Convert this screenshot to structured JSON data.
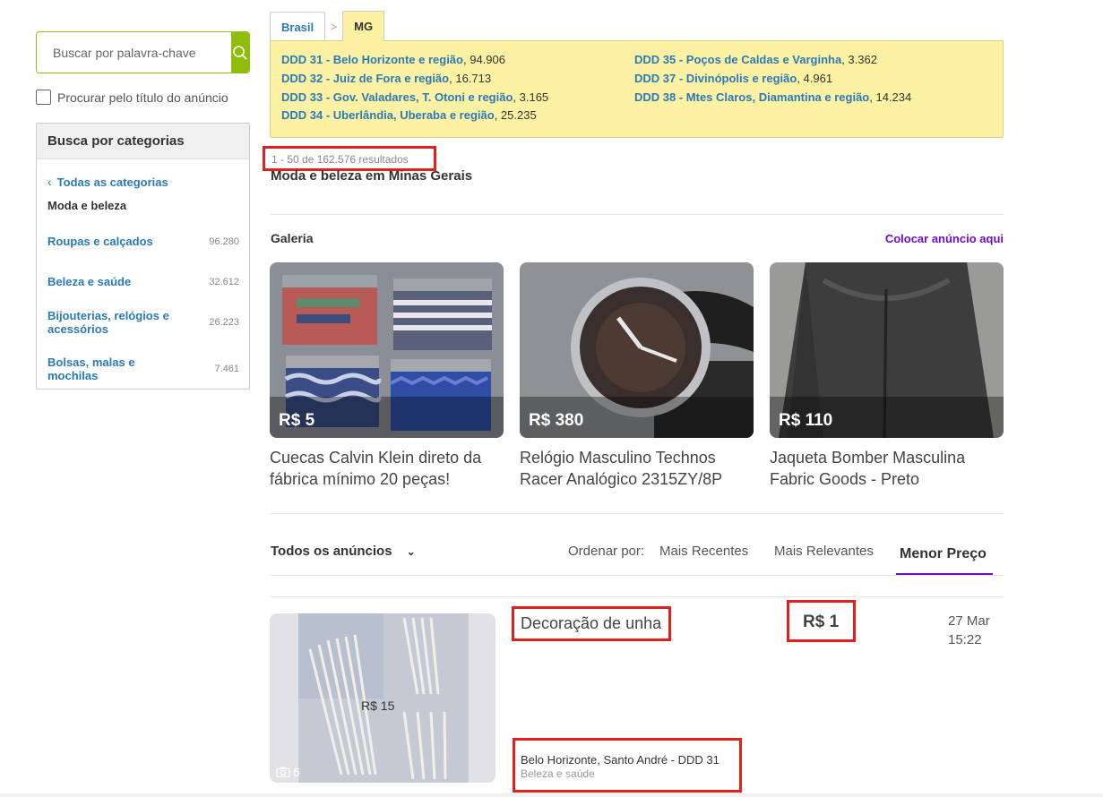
{
  "search": {
    "placeholder": "Buscar por palavra-chave",
    "title_only_label": "Procurar pelo título do anúncio"
  },
  "categories": {
    "heading": "Busca por categorias",
    "back_label": "Todas as categorias",
    "current": "Moda e beleza",
    "items": [
      {
        "label": "Roupas e calçados",
        "count": "96.280"
      },
      {
        "label": "Beleza e saúde",
        "count": "32.612"
      },
      {
        "label": "Bijouterias, relógios e acessórios",
        "count": "26.223"
      },
      {
        "label": "Bolsas, malas e mochilas",
        "count": "7.461"
      }
    ]
  },
  "location": {
    "tabs": [
      "Brasil",
      "MG"
    ],
    "separator": ">",
    "ddd": [
      {
        "name": "DDD 31 - Belo Horizonte e região",
        "count": ", 94.906"
      },
      {
        "name": "DDD 32 - Juiz de Fora e região",
        "count": ", 16.713"
      },
      {
        "name": "DDD 33 - Gov. Valadares, T. Otoni e região",
        "count": ", 3.165"
      },
      {
        "name": "DDD 34 - Uberlândia, Uberaba e região",
        "count": ", 25.235"
      },
      {
        "name": "DDD 35 - Poços de Caldas e Varginha",
        "count": ", 3.362"
      },
      {
        "name": "DDD 37 - Divinópolis e região",
        "count": ", 4.961"
      },
      {
        "name": "DDD 38 - Mtes Claros, Diamantina e região",
        "count": ", 14.234"
      }
    ]
  },
  "results": {
    "count_text": "1 - 50 de 162.576 resultados",
    "title": "Moda e beleza em Minas Gerais"
  },
  "gallery": {
    "label": "Galeria",
    "cta": "Colocar anúncio aqui",
    "cards": [
      {
        "price": "R$ 5",
        "title": "Cuecas Calvin Klein direto da fábrica mínimo 20 peças!"
      },
      {
        "price": "R$ 380",
        "title": "Relógio Masculino Technos Racer Analógico 2315ZY/8P"
      },
      {
        "price": "R$ 110",
        "title": "Jaqueta Bomber Masculina Fabric Goods - Preto"
      }
    ]
  },
  "toolbar": {
    "filter_label": "Todos os anúncios",
    "order_label": "Ordenar por:",
    "sort_options": [
      "Mais Recentes",
      "Mais Relevantes",
      "Menor Preço"
    ]
  },
  "ad": {
    "title": "Decoração de unha",
    "price": "R$ 1",
    "date": "27 Mar",
    "time": "15:22",
    "location": "Belo Horizonte, Santo André - DDD 31",
    "category": "Beleza e saúde",
    "photo_count": "6",
    "image_overlay_text": "R$ 15"
  },
  "colors": {
    "accent_green": "#8ebe0a",
    "link_blue": "#2a7ab8",
    "purple": "#6e0ad6",
    "highlight_red": "#e0201f",
    "ddd_bg": "#fdf2a3"
  }
}
